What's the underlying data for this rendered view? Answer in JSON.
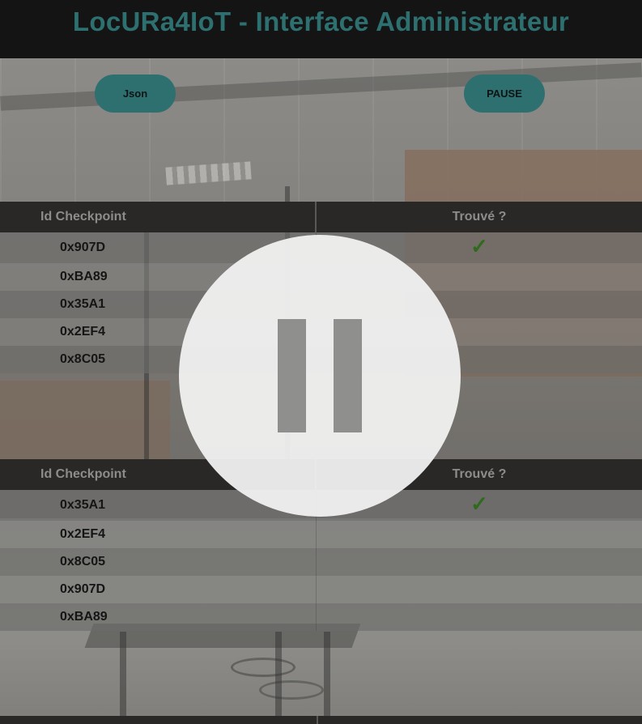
{
  "header": {
    "title": "LocURa4IoT - Interface Administrateur"
  },
  "toolbar": {
    "json_label": "Json",
    "pause_label": "PAUSE"
  },
  "tables": [
    {
      "columns": [
        "Id Checkpoint",
        "Trouvé ?"
      ],
      "rows": [
        {
          "id": "0x907D",
          "found": "✓"
        },
        {
          "id": "0xBA89",
          "found": ""
        },
        {
          "id": "0x35A1",
          "found": ""
        },
        {
          "id": "0x2EF4",
          "found": ""
        },
        {
          "id": "0x8C05",
          "found": ""
        }
      ]
    },
    {
      "columns": [
        "Id Checkpoint",
        "Trouvé ?"
      ],
      "rows": [
        {
          "id": "0x35A1",
          "found": "✓"
        },
        {
          "id": "0x2EF4",
          "found": ""
        },
        {
          "id": "0x8C05",
          "found": ""
        },
        {
          "id": "0x907D",
          "found": ""
        },
        {
          "id": "0xBA89",
          "found": ""
        }
      ]
    }
  ],
  "overlay": {
    "icon": "pause-icon"
  },
  "colors": {
    "accent": "#2e6f70",
    "header_bg": "#141414",
    "check": "#2f6a1d"
  }
}
